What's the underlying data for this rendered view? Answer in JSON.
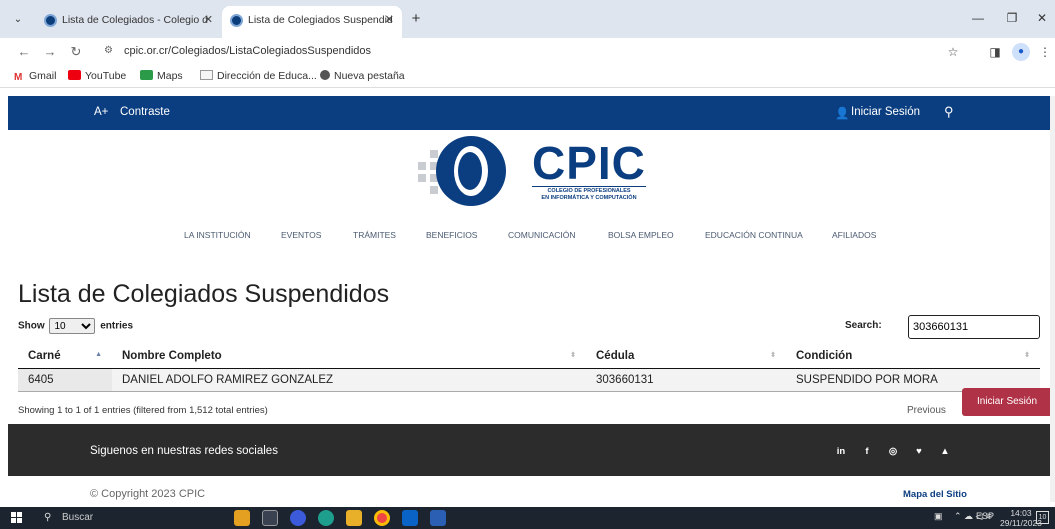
{
  "browser": {
    "tabs": [
      {
        "title": "Lista de Colegiados - Colegio d"
      },
      {
        "title": "Lista de Colegiados Suspendid"
      }
    ],
    "url": "cpic.or.cr/Colegiados/ListaColegiadosSuspendidos",
    "bookmarks": [
      "Gmail",
      "YouTube",
      "Maps",
      "Dirección de Educa...",
      "Nueva pestaña"
    ]
  },
  "topnav": {
    "font_size": "A+",
    "contrast": "Contraste",
    "login": "Iniciar Sesión"
  },
  "logo": {
    "name": "CPIC",
    "subtitle_1": "COLEGIO DE PROFESIONALES",
    "subtitle_2": "EN INFORMÁTICA Y COMPUTACIÓN"
  },
  "menu": [
    "LA INSTITUCIÓN",
    "EVENTOS",
    "TRÁMITES",
    "BENEFICIOS",
    "COMUNICACIÓN",
    "BOLSA EMPLEO",
    "EDUCACIÓN CONTINUA",
    "AFILIADOS"
  ],
  "main": {
    "title": "Lista de Colegiados Suspendidos",
    "show_label": "Show",
    "show_value": "10",
    "entries_label": "entries",
    "search_label": "Search:",
    "search_value": "303660131",
    "columns": [
      "Carné",
      "Nombre Completo",
      "Cédula",
      "Condición"
    ],
    "rows": [
      [
        "6405",
        "DANIEL ADOLFO RAMIREZ GONZALEZ",
        "303660131",
        "SUSPENDIDO POR MORA"
      ]
    ],
    "info": "Showing 1 to 1 of 1 entries (filtered from 1,512 total entries)",
    "previous": "Previous",
    "floating_login": "Iniciar Sesión"
  },
  "footer": {
    "social_text": "Siguenos en nuestras redes sociales",
    "social_icons": [
      "in",
      "f",
      "◎",
      "♥",
      "▲"
    ],
    "copyright": "© Copyright 2023 CPIC",
    "sitemap": "Mapa del Sitio"
  },
  "taskbar": {
    "search": "Buscar",
    "tray_lang": "ESP",
    "time": "14:03",
    "date": "29/11/2023",
    "notifications": "10"
  }
}
